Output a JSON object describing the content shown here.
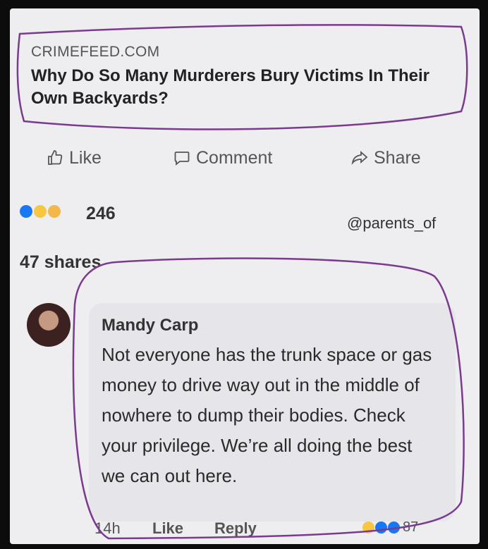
{
  "post": {
    "source": "CRIMEFEED.COM",
    "headline": "Why Do So Many Murderers Bury Victims In Their Own Backyards?"
  },
  "actions": {
    "like": "Like",
    "comment": "Comment",
    "share": "Share"
  },
  "reactions": {
    "count": "246",
    "icons": [
      "like-reaction-icon",
      "haha-reaction-icon",
      "wow-reaction-icon"
    ]
  },
  "watermark": "@parents_of",
  "shares_text": "47 shares",
  "comment": {
    "author": "Mandy Carp",
    "text": "Not everyone has the trunk space or gas money to drive way out in the middle of nowhere to dump their bodies. Check your privilege. We’re all doing the best we can out here.",
    "time": "14h",
    "like_label": "Like",
    "reply_label": "Reply",
    "reaction_count": "87"
  },
  "colors": {
    "annotation": "#7a3a8e",
    "like_blue": "#1877f2",
    "haha_yellow": "#f7c744",
    "love_red": "#e8445a"
  }
}
